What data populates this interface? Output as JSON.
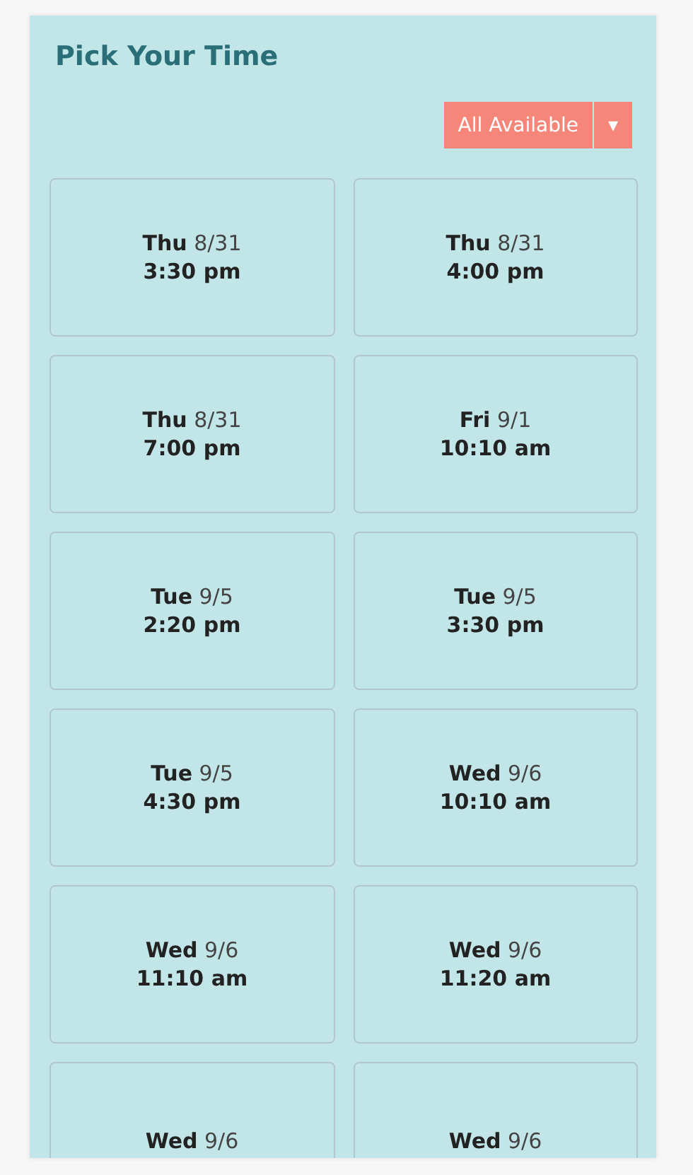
{
  "title": "Pick Your Time",
  "filter": {
    "label": "All Available",
    "caret": "▾"
  },
  "slots": [
    {
      "day": "Thu",
      "date": "8/31",
      "time": "3:30 pm"
    },
    {
      "day": "Thu",
      "date": "8/31",
      "time": "4:00 pm"
    },
    {
      "day": "Thu",
      "date": "8/31",
      "time": "7:00 pm"
    },
    {
      "day": "Fri",
      "date": "9/1",
      "time": "10:10 am"
    },
    {
      "day": "Tue",
      "date": "9/5",
      "time": "2:20 pm"
    },
    {
      "day": "Tue",
      "date": "9/5",
      "time": "3:30 pm"
    },
    {
      "day": "Tue",
      "date": "9/5",
      "time": "4:30 pm"
    },
    {
      "day": "Wed",
      "date": "9/6",
      "time": "10:10 am"
    },
    {
      "day": "Wed",
      "date": "9/6",
      "time": "11:10 am"
    },
    {
      "day": "Wed",
      "date": "9/6",
      "time": "11:20 am"
    },
    {
      "day": "Wed",
      "date": "9/6"
    },
    {
      "day": "Wed",
      "date": "9/6"
    }
  ]
}
